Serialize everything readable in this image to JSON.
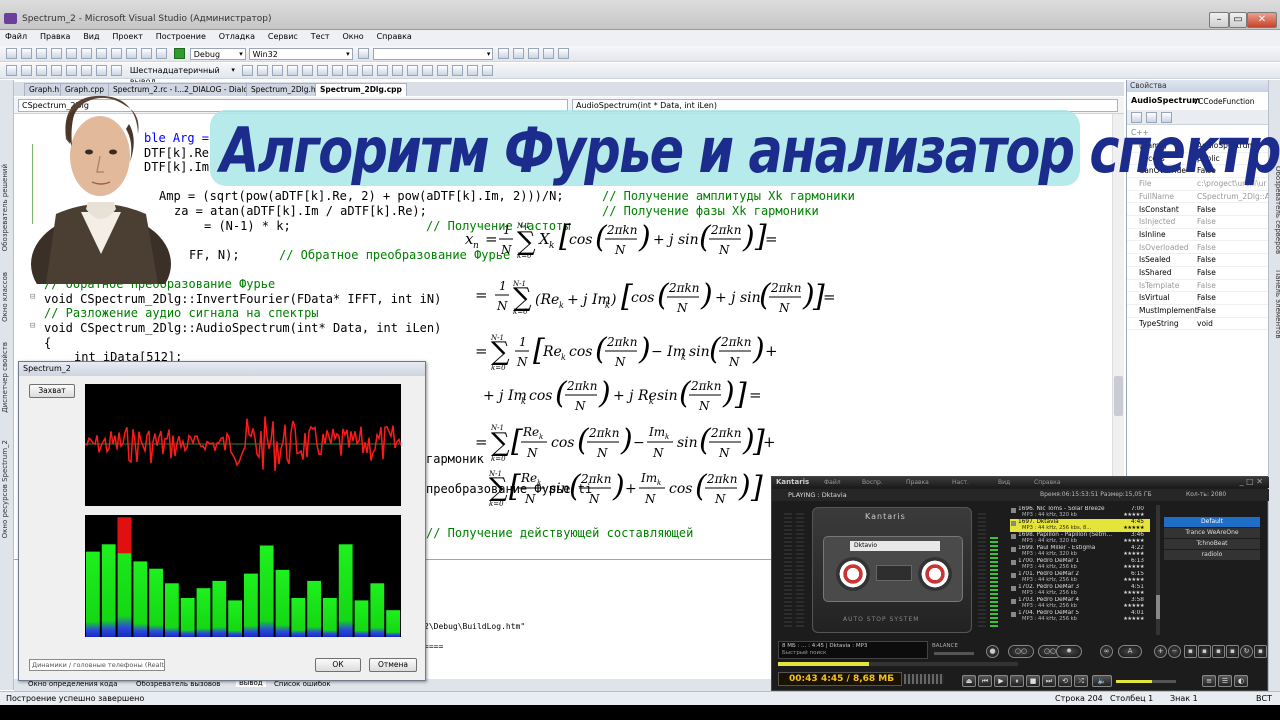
{
  "window": {
    "title": "Spectrum_2 - Microsoft Visual Studio (Администратор)"
  },
  "menu": [
    "Файл",
    "Правка",
    "Вид",
    "Проект",
    "Построение",
    "Отладка",
    "Сервис",
    "Тест",
    "Окно",
    "Справка"
  ],
  "toolbar": {
    "config": "Debug",
    "platform": "Win32",
    "hex_display": "Шестнадцатеричный вывод"
  },
  "doc_tabs": [
    "Graph.h",
    "Graph.cpp",
    "Spectrum_2.rc - I...2_DIALOG - Dialog",
    "Spectrum_2Dlg.h",
    "Spectrum_2Dlg.cpp"
  ],
  "nav": {
    "class": "CSpectrum_2Dlg",
    "member": "AudioSpectrum(int * Data, int iLen)"
  },
  "left_tabs": [
    "Обозреватель решений",
    "Окно классов",
    "Диспетчер свойств",
    "Окно ресурсов Spectrum_2"
  ],
  "code": {
    "l1": "ble Arg =",
    "l2": "DTF[k].Re",
    "l3": "DTF[k].Im",
    "l4a": "Amp = (sqrt(pow(aDTF[k].Re, 2) + pow(aDTF[k].Im, 2)))/N;",
    "l4c": "// Получение амплитуды Xk гармоники",
    "l5a": "za = atan(aDTF[k].Im / aDTF[k].Re);",
    "l5c": "// Получение фазы Xk гармоники",
    "l6a": "= (N-1) * k;",
    "l6c": "// Получение частоты",
    "l7a": "FF, N);",
    "l7c": "// Обратное преобразование Фурье",
    "l8c": "// Обратное преобразование Фурье",
    "l9": "void CSpectrum_2Dlg::InvertFourier(FData* IFFT, int iN)",
    "l10c": "// Разложение аудио сигнала на спектры",
    "l11": "void CSpectrum_2Dlg::AudioSpectrum(int* Data, int iLen)",
    "l12": "{",
    "l13": "int iData[512];",
    "l14": "гармоник",
    "l15": "преобразование Фурье ti",
    "l16c": "// Получение действующей составляющей",
    "buildlog": "2\\Debug\\BuildLog.htm\"",
    "sep": "===="
  },
  "banner": "Алгоритм Фурье и анализатор спектра",
  "properties": {
    "title": "Свойства",
    "object": "AudioSpectrum",
    "object_type": "VCCodeFunction",
    "category": "C++",
    "rows": [
      {
        "k": "(Name)",
        "v": "AudioSpectrum",
        "dim": false
      },
      {
        "k": "Access",
        "v": "public",
        "dim": false
      },
      {
        "k": "CanOverride",
        "v": "False",
        "dim": false
      },
      {
        "k": "File",
        "v": "c:\\progect\\uroki\\ur",
        "dim": true
      },
      {
        "k": "FullName",
        "v": "CSpectrum_2Dlg::A",
        "dim": true
      },
      {
        "k": "IsConstant",
        "v": "False",
        "dim": false
      },
      {
        "k": "IsInjected",
        "v": "False",
        "dim": true
      },
      {
        "k": "IsInline",
        "v": "False",
        "dim": false
      },
      {
        "k": "IsOverloaded",
        "v": "False",
        "dim": true
      },
      {
        "k": "IsSealed",
        "v": "False",
        "dim": false
      },
      {
        "k": "IsShared",
        "v": "False",
        "dim": false
      },
      {
        "k": "IsTemplate",
        "v": "False",
        "dim": true
      },
      {
        "k": "IsVirtual",
        "v": "False",
        "dim": false
      },
      {
        "k": "MustImplement",
        "v": "False",
        "dim": false
      },
      {
        "k": "TypeString",
        "v": "void",
        "dim": false
      }
    ]
  },
  "right_tabs": [
    "Обозреватель серверов",
    "Панель элементов"
  ],
  "dialog": {
    "title": "Spectrum_2",
    "capture": "Захват",
    "device": "Динамики / головные телефоны (Realt",
    "ok": "ОК",
    "cancel": "Отмена",
    "bars": [
      0.7,
      0.76,
      0.98,
      0.62,
      0.56,
      0.44,
      0.32,
      0.4,
      0.46,
      0.3,
      0.52,
      0.75,
      0.55,
      0.32,
      0.46,
      0.32,
      0.76,
      0.3,
      0.44,
      0.22
    ]
  },
  "status": {
    "message": "Построение успешно завершено",
    "line": "Строка 204",
    "col": "Столбец 1",
    "char": "Знак 1",
    "mode": "ВСТ"
  },
  "bottom_tabs": [
    "Окно определения кода",
    "Обозреватель вызовов",
    "Вывод",
    "Список ошибок"
  ],
  "player": {
    "app": "Kantaris",
    "menu": [
      "Файл",
      "Воспр.",
      "Правка",
      "Наст.",
      "Вид",
      "Справка"
    ],
    "now_playing": "PLAYING : Dktavia",
    "info": "Время:06:15:53:51  Размер:15,05 ГБ",
    "counter": "Кол-ть: 2080",
    "cassette_label": "Kantaris",
    "cassette_title": "Dktavio",
    "auto_stop": "AUTO STOP SYSTEM",
    "balance": "BALANCE",
    "small_display": "8 МБ :  ...  :  4:45  |  Dktavia  :  MP3",
    "search": "Быстрый поиск",
    "time": "00:43",
    "time2": "4:45 / 8,68 МБ",
    "playlist": [
      {
        "t": "1696. Nic Toms - Solar Breeze",
        "d": "7:00",
        "m": "MP3 : 44 kHz, 320 kb"
      },
      {
        "t": "1697. Dktavia",
        "d": "4:45",
        "m": "MP3 : 44 kHz, 256 kbs, 8..."
      },
      {
        "t": "1698. Papillon - Papillon (Setm...",
        "d": "3:46",
        "m": "MP3 : 44 kHz, 320 kb"
      },
      {
        "t": "1699. Paul Miller - Estigma",
        "d": "4:22",
        "m": "MP3 : 44 kHz, 320 kb"
      },
      {
        "t": "1700. Pedro DeMar 1",
        "d": "6:13",
        "m": "MP3 : 44 kHz, 256 kb"
      },
      {
        "t": "1701. Pedro DeMar 2",
        "d": "6:15",
        "m": "MP3 : 44 kHz, 256 kb"
      },
      {
        "t": "1702. Pedro DeMar 3",
        "d": "4:51",
        "m": "MP3 : 44 kHz, 256 kb"
      },
      {
        "t": "1703. Pedro DeMar 4",
        "d": "3:58",
        "m": "MP3 : 44 kHz, 256 kb"
      },
      {
        "t": "1704. Pedro DeMar 5",
        "d": "4:01",
        "m": "MP3 : 44 kHz, 256 kb"
      }
    ],
    "presets": [
      "Default",
      "Trance WeAreOne",
      "TchnoBeat",
      "radiolo"
    ]
  },
  "colors": {
    "banner_text": "#1b2c8c",
    "banner_bg": "#aae6e6",
    "signal": "#ff1a1a",
    "bar_green": "#14e614",
    "bar_red": "#e01010",
    "player_accent": "#e4e43a"
  }
}
